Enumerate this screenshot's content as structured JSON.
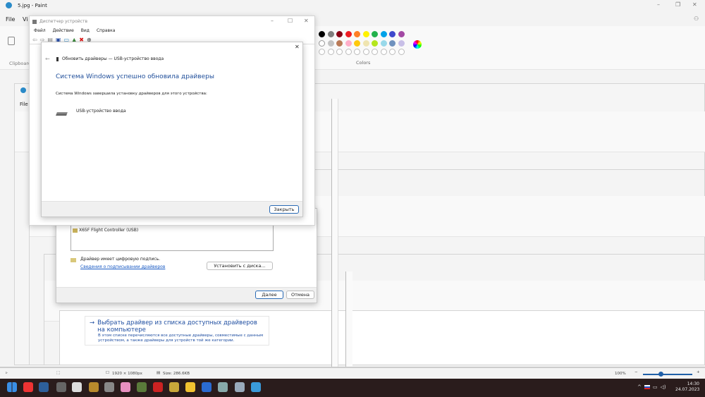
{
  "paint": {
    "title": "5.jpg - Paint",
    "menu": [
      "File",
      "Vi"
    ],
    "clipboard_label": "Clipboard",
    "colors_label": "Colors",
    "nested_file": "File",
    "nested_clip": "Cl",
    "palette": {
      "row1": [
        "#000000",
        "#7f7f7f",
        "#880015",
        "#ed1c24",
        "#ff7f27",
        "#fff200",
        "#22b14c",
        "#00a2e8",
        "#3f48cc",
        "#a349a4"
      ],
      "row2": [
        "#ffffff",
        "#c3c3c3",
        "#b97a57",
        "#ffaec9",
        "#ffc90e",
        "#efe4b0",
        "#b5e61d",
        "#99d9ea",
        "#7092be",
        "#c8bfe7"
      ]
    }
  },
  "device_manager": {
    "title": "Диспетчер устройств",
    "menu": [
      "Файл",
      "Действие",
      "Вид",
      "Справка"
    ]
  },
  "update_dialog": {
    "header": "Обновить драйверы — USB-устройство ввода",
    "heading": "Система Windows успешно обновила драйверы",
    "message": "Система Windows завершила установку драйверов для этого устройства:",
    "device": "USB-устройство ввода",
    "close_button": "Закрыть"
  },
  "select_dialog": {
    "list_item": "X65F Flight Controller (USB)",
    "signed": "Драйвер имеет цифровую подпись.",
    "signing_link": "Сведения о подписывании драйверов",
    "install_disk": "Установить с диска...",
    "next": "Далее",
    "cancel": "Отмена"
  },
  "browse_option": {
    "title": "Выбрать драйвер из списка доступных драйверов на компьютере",
    "description": "В этом списке перечисляются все доступные драйверы, совместимые с данным устройством, а также драйверы для устройств той же категории."
  },
  "statusbar": {
    "dimensions": "1920 × 1080px",
    "size": "Size: 286.6KB",
    "zoom": "100%",
    "zoom_level_percent": 100
  },
  "taskbar": {
    "time": "14:30",
    "date": "24.07.2023"
  }
}
